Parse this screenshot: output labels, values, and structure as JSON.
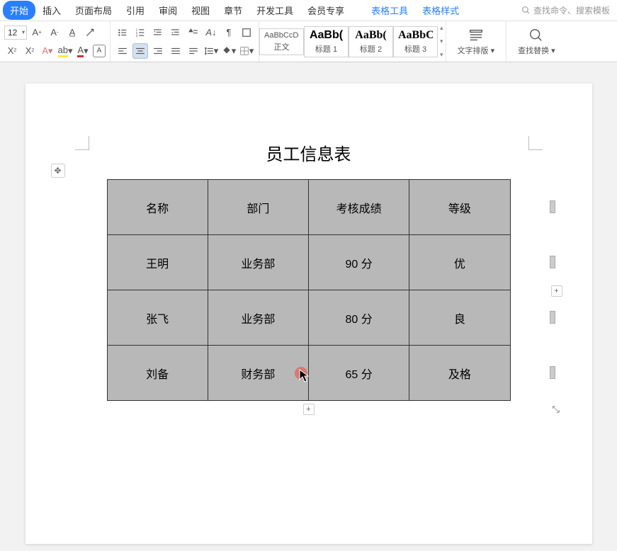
{
  "menu": {
    "tabs": [
      "开始",
      "插入",
      "页面布局",
      "引用",
      "审阅",
      "视图",
      "章节",
      "开发工具",
      "会员专享"
    ],
    "contextual": [
      "表格工具",
      "表格样式"
    ],
    "search_placeholder": "查找命令、搜索模板"
  },
  "toolbar": {
    "font_size": "12",
    "styles": [
      {
        "preview": "AaBbCcDd",
        "label": "正文",
        "big": false,
        "serif": false
      },
      {
        "preview": "AaBb(",
        "label": "标题 1",
        "big": true,
        "serif": false
      },
      {
        "preview": "AaBb(",
        "label": "标题 2",
        "big": true,
        "serif": true
      },
      {
        "preview": "AaBbC(",
        "label": "标题 3",
        "big": true,
        "serif": true
      }
    ],
    "text_layout": "文字排版",
    "find_replace": "查找替换"
  },
  "document": {
    "title": "员工信息表",
    "table": {
      "headers": [
        "名称",
        "部门",
        "考核成绩",
        "等级"
      ],
      "rows": [
        [
          "王明",
          "业务部",
          "90 分",
          "优"
        ],
        [
          "张飞",
          "业务部",
          "80 分",
          "良"
        ],
        [
          "刘备",
          "财务部",
          "65 分",
          "及格"
        ]
      ]
    }
  },
  "ui_glyphs": {
    "plus": "+",
    "move": "✥",
    "resize": "⤡",
    "dropdown": "▾"
  }
}
